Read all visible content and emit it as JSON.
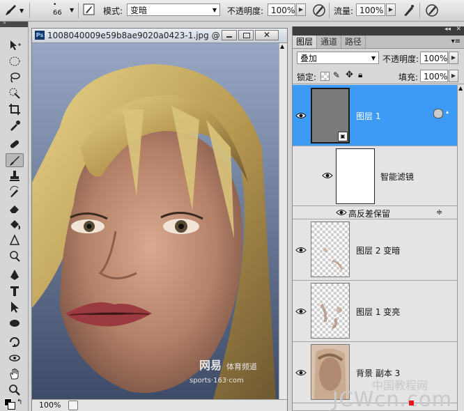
{
  "options_bar": {
    "brush_size": "66",
    "mode_label": "模式:",
    "mode_value": "变暗",
    "opacity_label": "不透明度:",
    "opacity_value": "100%",
    "flow_label": "流量:",
    "flow_value": "100%"
  },
  "document": {
    "title": "1008040009e59b8ae9020a0423-1.jpg @ 1...",
    "ps_badge": "Ps",
    "zoom": "100%",
    "photo_watermark_brand": "网易",
    "photo_watermark_channel": "体育频道",
    "photo_watermark_url": "sports·163·com"
  },
  "layers_panel": {
    "tabs": [
      "图层",
      "通道",
      "路径"
    ],
    "blend_mode": "叠加",
    "opacity_label": "不透明度:",
    "opacity_value": "100%",
    "lock_label": "锁定:",
    "fill_label": "填充:",
    "fill_value": "100%",
    "layers": [
      {
        "name": "图层 1",
        "selected": true
      },
      {
        "name": "智能滤镜"
      },
      {
        "name": "高反差保留"
      },
      {
        "name": "图层 2 变暗"
      },
      {
        "name": "图层 1 变亮"
      },
      {
        "name": "背景 副本 3"
      }
    ]
  },
  "site_watermark": {
    "line1": "中国教程网",
    "line2": "JCWcn.com"
  },
  "colors": {
    "selected_layer": "#3d9bf5",
    "watermark_dot": "#e8141b"
  }
}
